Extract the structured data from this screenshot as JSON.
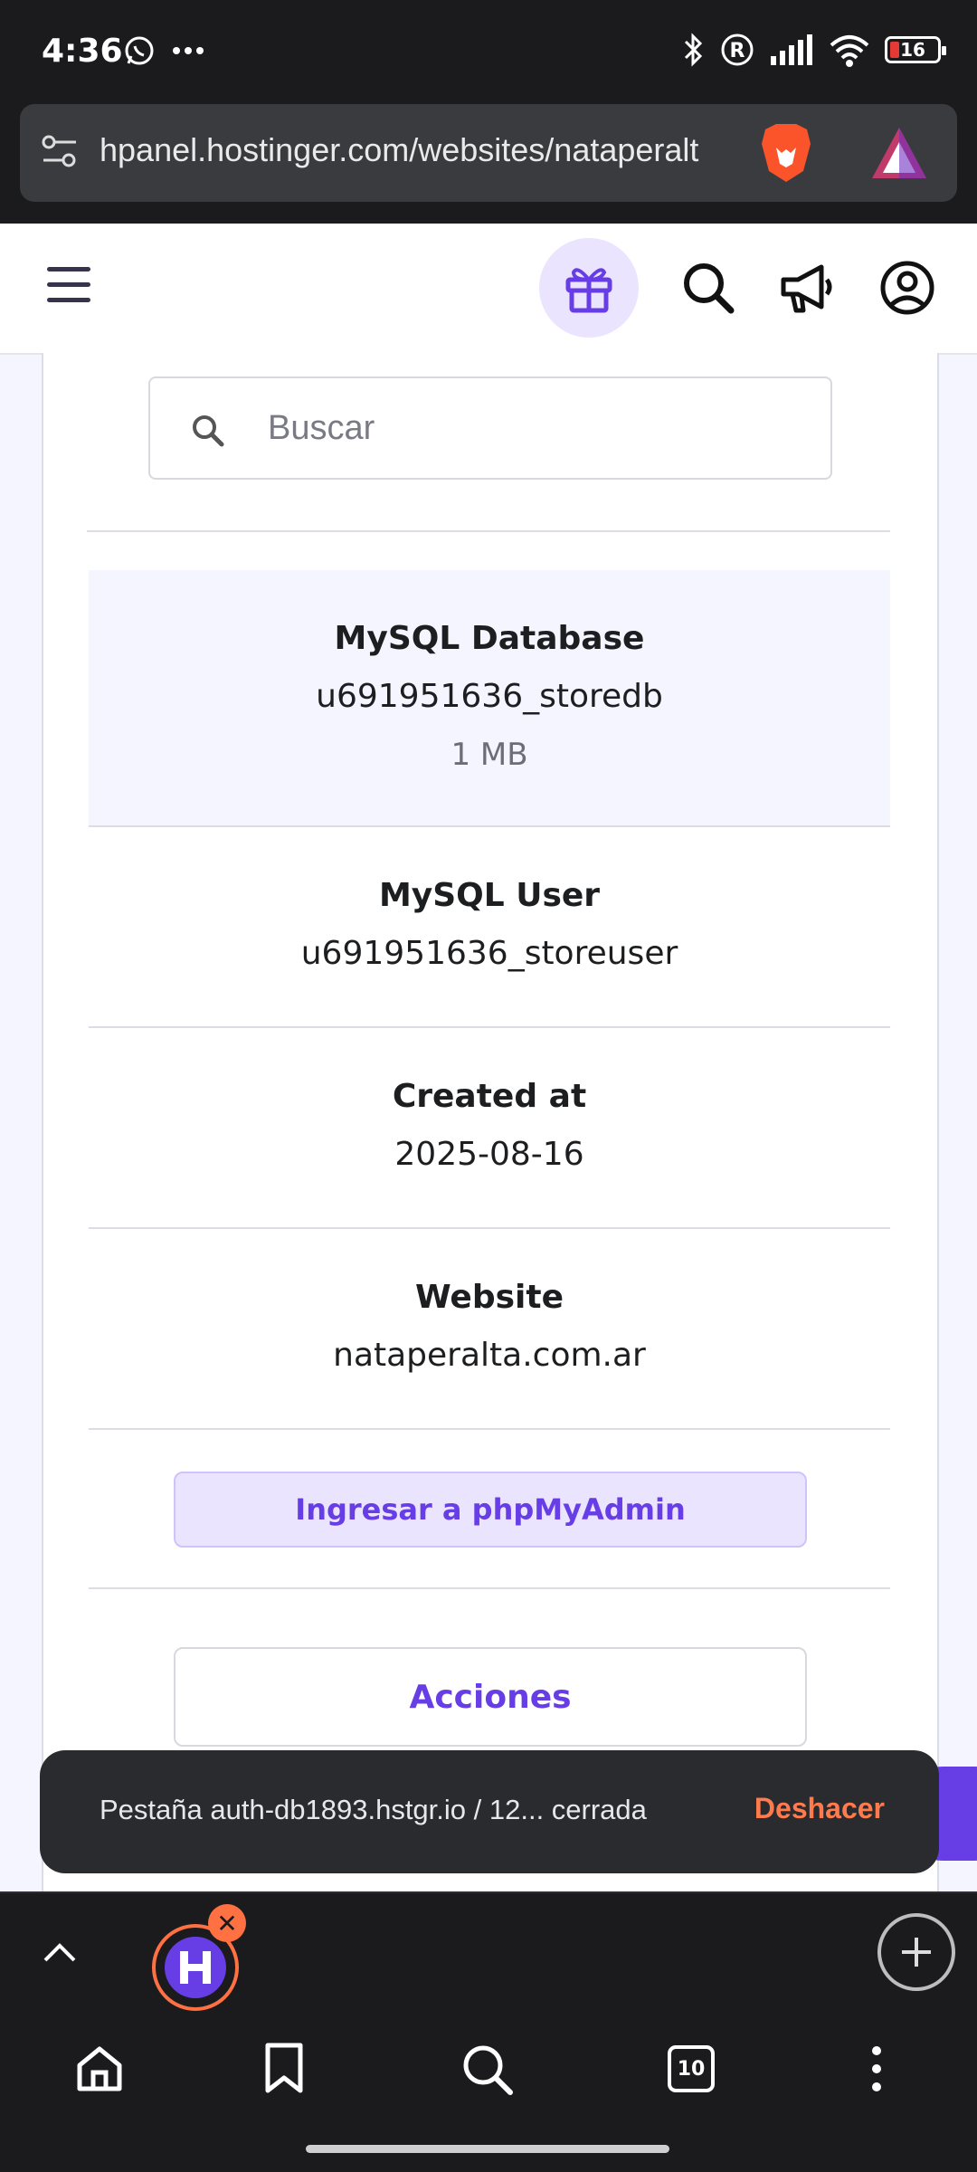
{
  "status_bar": {
    "time": "4:36",
    "battery": "16",
    "icons": [
      "whatsapp-icon",
      "more-dots-icon",
      "bluetooth-icon",
      "registered-icon",
      "signal-icon",
      "wifi-icon",
      "battery-icon"
    ]
  },
  "browser": {
    "url": "hpanel.hostinger.com/websites/nataperalt",
    "tab_count": "10"
  },
  "search": {
    "placeholder": "Buscar"
  },
  "database": {
    "db_label": "MySQL Database",
    "db_name": "u691951636_storedb",
    "db_size": "1 MB",
    "user_label": "MySQL User",
    "user_name": "u691951636_storeuser",
    "created_label": "Created at",
    "created_value": "2025-08-16",
    "website_label": "Website",
    "website_value": "nataperalta.com.ar",
    "phpmyadmin_button": "Ingresar a phpMyAdmin",
    "actions_button": "Acciones"
  },
  "toast": {
    "message": "Pestaña auth-db1893.hstgr.io / 12... cerrada",
    "undo": "Deshacer"
  },
  "colors": {
    "accent": "#673de6",
    "accent_light": "#ebe4ff",
    "toast_action": "#ff7a4d"
  }
}
